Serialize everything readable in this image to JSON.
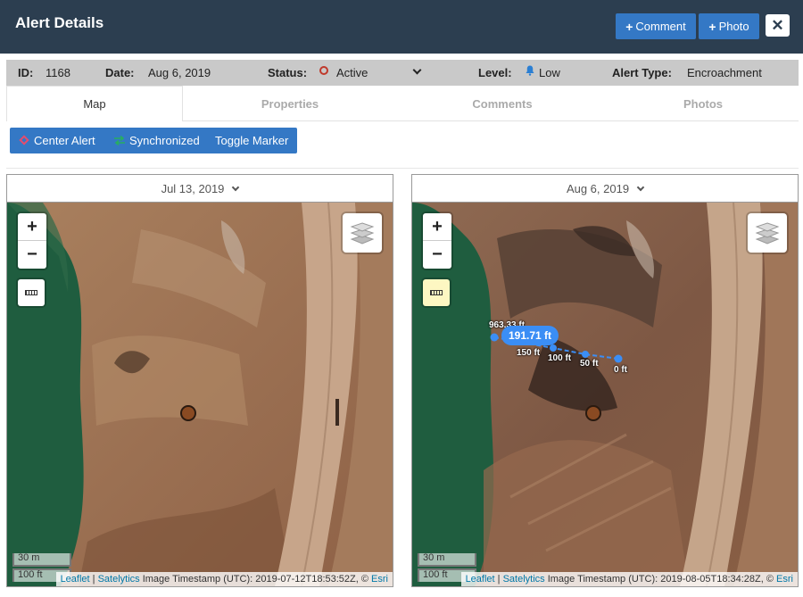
{
  "header": {
    "title": "Alert Details",
    "comment_label": "Comment",
    "photo_label": "Photo",
    "close_glyph": "✕"
  },
  "info": {
    "id_label": "ID:",
    "id_value": "1168",
    "date_label": "Date:",
    "date_value": "Aug 6, 2019",
    "status_label": "Status:",
    "status_value": "Active",
    "level_label": "Level:",
    "level_value": "Low",
    "type_label": "Alert Type:",
    "type_value": "Encroachment"
  },
  "tabs": [
    {
      "label": "Map",
      "active": true
    },
    {
      "label": "Properties",
      "active": false
    },
    {
      "label": "Comments",
      "active": false
    },
    {
      "label": "Photos",
      "active": false
    }
  ],
  "toolbar": {
    "center_label": "Center Alert",
    "sync_label": "Synchronized",
    "toggle_label": "Toggle Marker"
  },
  "maps": [
    {
      "date": "Jul 13, 2019",
      "zoom_in": "+",
      "zoom_out": "−",
      "scale_m": "30 m",
      "scale_ft": "100 ft",
      "attrib_leaflet": "Leaflet",
      "attrib_sep": " | ",
      "attrib_satelytics": "Satelytics",
      "attrib_text": " Image Timestamp (UTC): 2019-07-12T18:53:52Z, © ",
      "attrib_esri": "Esri",
      "measure_active": false
    },
    {
      "date": "Aug 6, 2019",
      "zoom_in": "+",
      "zoom_out": "−",
      "scale_m": "30 m",
      "scale_ft": "100 ft",
      "attrib_leaflet": "Leaflet",
      "attrib_sep": " | ",
      "attrib_satelytics": "Satelytics",
      "attrib_text": " Image Timestamp (UTC): 2019-08-05T18:34:28Z, © ",
      "attrib_esri": "Esri",
      "measure_active": true,
      "measurement": {
        "total": "191.71 ft",
        "labels": [
          "963.33 ft",
          "150 ft",
          "100 ft",
          "50 ft",
          "0 ft"
        ]
      }
    }
  ],
  "colors": {
    "header_bg": "#2c3e50",
    "button_blue": "#3478c5",
    "infobar_bg": "#c9c9c9",
    "status_red": "#c0392b",
    "measure_blue": "#3b8ef5"
  }
}
